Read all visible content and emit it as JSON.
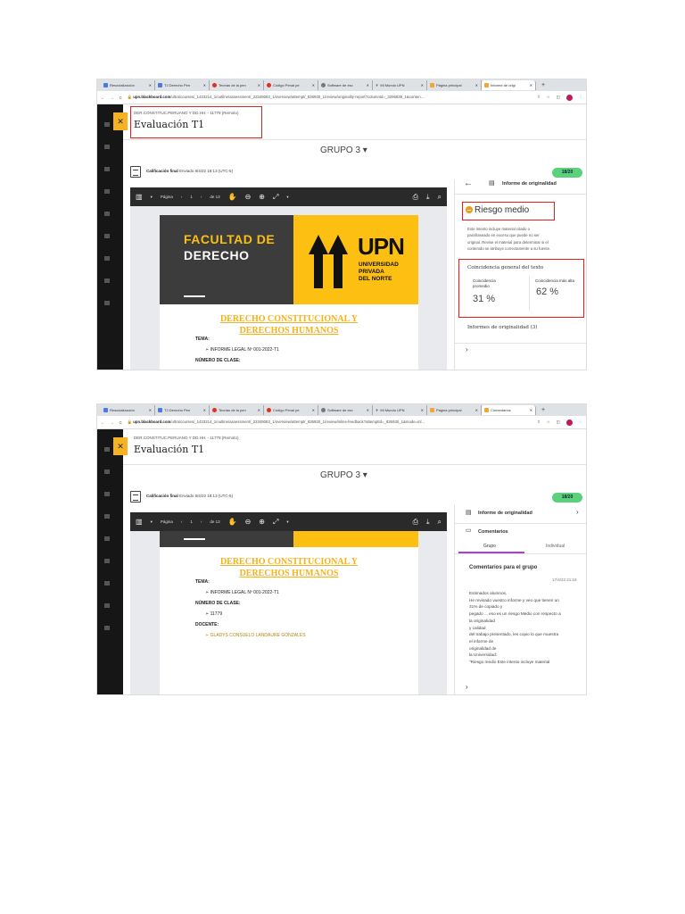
{
  "browser": {
    "tabs": [
      "Resocialización",
      "T2.Derecho Pen",
      "Teorías de la pen",
      "Código Penal pe",
      "Software de esc",
      "Mi Mundo UPN",
      "Página principal"
    ],
    "active_tab_1": "Informe de origi",
    "active_tab_2": "Comentarios",
    "url_domain": "upn.blackboard.com",
    "url_path_1": "/ultra/courses/_1433214_1/outline/assessment/_22349083_1/overview/attempt/_836930_1/review/originality-report?columnId=_3296839_1&conten...",
    "url_path_2": "/ultra/courses/_1433214_1/outline/assessment/_22349083_1/overview/attempt/_836930_1/review/inline-feedback?attemptId=_836930_1&mode=inl...",
    "avatar_letter": "V"
  },
  "header": {
    "course": "DER.CONSTITUC.PERUANO Y DD.HH. - 11779 (Remoto)",
    "title": "Evaluación T1",
    "group": "GRUPO 3 ▾",
    "close": "✕"
  },
  "grade": {
    "label": "Calificación final",
    "submitted": "Enviado 8/4/22 18:13 (UTC-5)",
    "score": "18/20"
  },
  "pdf": {
    "page_label": "Página",
    "page": "1",
    "of": "de 13"
  },
  "document": {
    "banner_line1": "FACULTAD DE",
    "banner_line2": "DERECHO",
    "logo": "UPN",
    "univ": [
      "UNIVERSIDAD",
      "PRIVADA",
      "DEL NORTE"
    ],
    "title1": "DERECHO CONSTITUCIONAL Y",
    "title2": "DERECHOS HUMANOS",
    "tema_label": "TEMA:",
    "tema": "➢  INFORME LEGAL Nº 001-2022-T1",
    "clase_label": "NÚMERO DE CLASE:",
    "clase": "➢  11779",
    "docente_label": "DOCENTE:",
    "docente": "➢  GLADYS CONSUELO LANDAURE GONZALES"
  },
  "originality": {
    "panel_title": "Informe de originalidad",
    "risk": "Riesgo medio",
    "risk_desc": [
      "Este intento incluye material citado o",
      "parafraseado en exceso que puede no ser",
      "original. Revise el material para determinar si el",
      "contenido se atribuye correctamente a su fuente."
    ],
    "general": "Coincidencia general del texto",
    "avg_label1": "Coincidencia",
    "avg_label2": "promedio",
    "avg": "31 %",
    "max_label": "Coincidencia más alta",
    "max": "62 %",
    "reports": "Informes de originalidad (3)"
  },
  "comments": {
    "originality_link": "Informe de originalidad",
    "title": "Comentarios",
    "tab_group": "Grupo",
    "tab_individual": "Individual",
    "heading": "Comentarios para el grupo",
    "date": "17/4/22 21:16",
    "lines": [
      "Estimados alumnos,",
      "He revisado vuestro informe y veo que tienen un",
      "31% de copiado y",
      "pegado ... eso es un riesgo Medio con respecto a",
      "la originalidad",
      "y calidad",
      "del trabajo presentado, les copio lo que muestra",
      "el informe de",
      "originalidad de",
      "la Universidad:",
      "\"Riesgo medio Este intento incluye material"
    ]
  },
  "colors": {
    "accent": "#f5b324",
    "badge": "#5ad17a",
    "highlight": "#e0201b",
    "risk": "#f29a13"
  }
}
